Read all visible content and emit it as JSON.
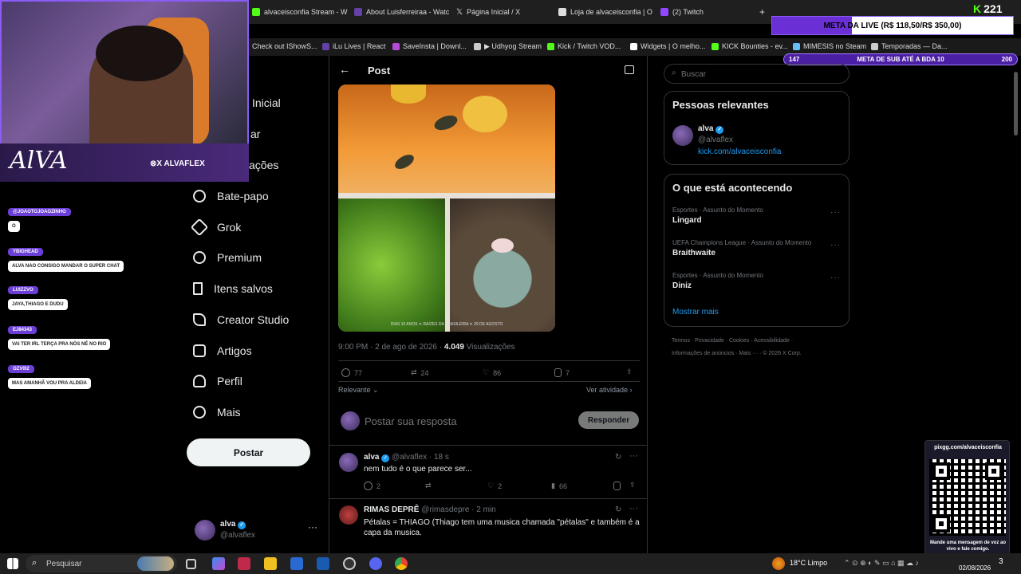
{
  "browser": {
    "tabs": [
      {
        "label": "alvaceisconfia Stream - W",
        "color": "#53fc18"
      },
      {
        "label": "About Luisferreiraa - Watc",
        "color": "#6441a5"
      },
      {
        "label": "Página Inicial / X",
        "color": "#ffffff"
      },
      {
        "label": "Loja de alvaceisconfia | O",
        "color": "#dddddd"
      },
      {
        "label": "(2) Twitch",
        "color": "#9146ff"
      }
    ],
    "new_tab_label": "+",
    "bookmarks": [
      "Check out IShowS...",
      "iLu Lives | React",
      "SaveInsta | Downl...",
      "▶ Udhyog Stream",
      "Kick / Twitch VOD...",
      "Widgets | O melho...",
      "KICK Bounties - ev...",
      "MIMESIS no Steam",
      "Temporadas — Da..."
    ]
  },
  "overlay": {
    "kick_count": "221",
    "meta_live": "META DA LIVE (R$ 118,50/R$ 350,00)",
    "meta_sub_left": "147",
    "meta_sub_label": "META DE SUB ATÉ A BDA 10",
    "meta_sub_right": "200",
    "signature": "AlVA",
    "cam_handle": "⊗X ALVAFLEX",
    "chat": [
      {
        "user": "@JOAOTOJOAOZINHO",
        "text": "O"
      },
      {
        "user": "YBIGHEAD",
        "text": "ALVA NAO CONSIGO MANDAR O SUPER CHAT"
      },
      {
        "user": "LUIZZVO",
        "text": "JAYA,THIAGO E DUDU"
      },
      {
        "user": "EJ84343",
        "text": "VAI TER IRL TERÇA PRA NÓS NÉ NO RIO"
      },
      {
        "user": "OZV0I2",
        "text": "MAS AMANHÃ VOU PRA ALDEIA"
      }
    ],
    "qr_url": "pixgg.com/alvaceisconfia",
    "qr_caption": "Mande uma mensagem de voz ao vivo e fale comigo."
  },
  "sidebar": {
    "partial_items": [
      "Inicial",
      "ar",
      "ações"
    ],
    "items": [
      {
        "label": "Bate-papo",
        "icon": "chat-icon"
      },
      {
        "label": "Grok",
        "icon": "grok-icon"
      },
      {
        "label": "Premium",
        "icon": "premium-icon"
      },
      {
        "label": "Itens salvos",
        "icon": "bookmark-icon"
      },
      {
        "label": "Creator Studio",
        "icon": "rocket-icon"
      },
      {
        "label": "Artigos",
        "icon": "article-icon"
      },
      {
        "label": "Perfil",
        "icon": "profile-icon"
      },
      {
        "label": "Mais",
        "icon": "more-icon"
      }
    ],
    "post_button": "Postar",
    "account": {
      "name": "alva",
      "handle": "@alvaflex"
    },
    "account_more": "···"
  },
  "post": {
    "header_title": "Post",
    "image_caption": "DIAS 10 ANOS   ✕   RAÍZES DA BRASILEIRA   ✕   29 DE AGOSTO",
    "time": "9:00 PM · 2 de ago de 2026 · ",
    "views_count": "4.049",
    "views_label": " Visualizações",
    "replies": "77",
    "reposts": "24",
    "likes": "86",
    "bookmarks": "7",
    "sort_label": "Relevante",
    "activity_label": "Ver atividade",
    "reply_placeholder": "Postar sua resposta",
    "reply_button": "Responder"
  },
  "replies": [
    {
      "name": "alva",
      "handle": "@alvaflex · 18 s",
      "text": "nem tudo é o que parece ser...",
      "replies": "2",
      "likes": "2",
      "views": "66"
    },
    {
      "name": "RIMAS DEPRÊ",
      "handle": "@rimasdepre · 2 min",
      "text": "Pétalas = THIAGO (Thiago tem uma musica chamada \"pétalas\" e também é a capa da musica."
    }
  ],
  "right": {
    "search_placeholder": "Buscar",
    "relevant_title": "Pessoas relevantes",
    "relevant_person": {
      "name": "alva",
      "handle": "@alvaflex",
      "link": "kick.com/alvaceisconfia"
    },
    "trending_title": "O que está acontecendo",
    "trends": [
      {
        "category": "Esportes · Assunto do Momento",
        "name": "Lingard"
      },
      {
        "category": "UEFA Champions League · Assunto do Momento",
        "name": "Braithwaite"
      },
      {
        "category": "Esportes · Assunto do Momento",
        "name": "Diniz"
      }
    ],
    "show_more": "Mostrar mais",
    "footer_line1": "Termos · Privacidade · Cookies · Acessibilidade ·",
    "footer_line2": "Informações de anúncios · Mais ··· · © 2026 X Corp."
  },
  "taskbar": {
    "search_placeholder": "Pesquisar",
    "weather": "18°C  Limpo",
    "date": "02/08/2026",
    "notification_count": "3"
  }
}
